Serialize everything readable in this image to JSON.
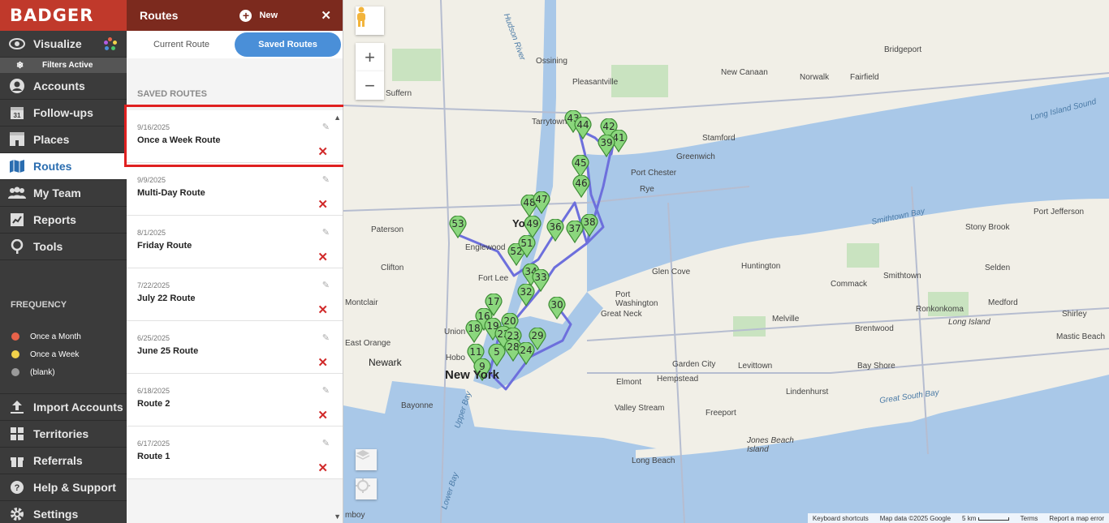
{
  "brand": "BADGER",
  "nav": {
    "visualize": "Visualize",
    "filters_active": "Filters Active",
    "accounts": "Accounts",
    "followups": "Follow-ups",
    "followups_day": "31",
    "places": "Places",
    "routes": "Routes",
    "my_team": "My Team",
    "reports": "Reports",
    "tools": "Tools",
    "import_accounts": "Import Accounts",
    "territories": "Territories",
    "referrals": "Referrals",
    "help": "Help & Support",
    "settings": "Settings"
  },
  "frequency": {
    "title": "FREQUENCY",
    "items": [
      {
        "label": "Once a Month",
        "color": "#e8624a"
      },
      {
        "label": "Once a Week",
        "color": "#f2d24b"
      },
      {
        "label": "(blank)",
        "color": "#9a9a9a"
      }
    ]
  },
  "panel": {
    "title": "Routes",
    "new_label": "New",
    "tab_current": "Current Route",
    "tab_saved": "Saved Routes",
    "section_label": "SAVED ROUTES",
    "routes": [
      {
        "date": "9/16/2025",
        "name": "Once a Week Route"
      },
      {
        "date": "9/9/2025",
        "name": "Multi-Day Route"
      },
      {
        "date": "8/1/2025",
        "name": "Friday Route"
      },
      {
        "date": "7/22/2025",
        "name": "July 22 Route"
      },
      {
        "date": "6/25/2025",
        "name": "June 25 Route"
      },
      {
        "date": "6/18/2025",
        "name": "Route 2"
      },
      {
        "date": "6/17/2025",
        "name": "Route 1"
      }
    ]
  },
  "map": {
    "labels": {
      "ossining": "Ossining",
      "pleasantville": "Pleasantville",
      "new_canaan": "New Canaan",
      "bridgeport": "Bridgeport",
      "fairfield": "Fairfield",
      "norwalk": "Norwalk",
      "suffern": "Suffern",
      "tarrytown": "Tarrytown",
      "stamford": "Stamford",
      "greenwich": "Greenwich",
      "port_chester": "Port Chester",
      "rye": "Rye",
      "long_island_sound": "Long Island Sound",
      "paterson": "Paterson",
      "englewood": "Englewood",
      "yonkers": "Yo",
      "smithtown_bay": "Smithtown Bay",
      "port_jefferson": "Port Jefferson",
      "stony_brook": "Stony Brook",
      "clifton": "Clifton",
      "fort_lee": "Fort Lee",
      "glen_cove": "Glen Cove",
      "huntington": "Huntington",
      "smithtown": "Smithtown",
      "selden": "Selden",
      "commack": "Commack",
      "montclair": "Montclair",
      "port_washington": "Port\nWashington",
      "great_neck": "Great Neck",
      "ronkonkoma": "Ronkonkoma",
      "medford": "Medford",
      "shirley": "Shirley",
      "east_orange": "East Orange",
      "union": "Union",
      "melville": "Melville",
      "brentwood": "Brentwood",
      "long_island": "Long Island",
      "mastic_beach": "Mastic Beach",
      "newark": "Newark",
      "hoboken": "Hobo",
      "new_york": "New York",
      "garden_city": "Garden City",
      "hempstead": "Hempstead",
      "levittown": "Levittown",
      "bay_shore": "Bay Shore",
      "elmont": "Elmont",
      "lindenhurst": "Lindenhurst",
      "great_south_bay": "Great South Bay",
      "bayonne": "Bayonne",
      "valley_stream": "Valley Stream",
      "freeport": "Freeport",
      "upper_bay": "Upper Bay",
      "jones_beach": "Jones Beach\nIsland",
      "long_beach": "Long Beach",
      "lower_bay": "Lower Bay",
      "amboy": "mboy",
      "hudson_river": "Hudson River"
    },
    "pins": [
      "53",
      "48",
      "47",
      "49",
      "36",
      "37",
      "38",
      "52",
      "51",
      "34",
      "33",
      "32",
      "30",
      "17",
      "16",
      "19",
      "20",
      "18",
      "22",
      "23",
      "29",
      "28",
      "24",
      "11",
      "5",
      "9",
      "43",
      "44",
      "42",
      "41",
      "45",
      "46",
      "39"
    ],
    "attribution": {
      "shortcuts": "Keyboard shortcuts",
      "data": "Map data ©2025 Google",
      "scale": "5 km",
      "terms": "Terms",
      "report": "Report a map error"
    }
  }
}
